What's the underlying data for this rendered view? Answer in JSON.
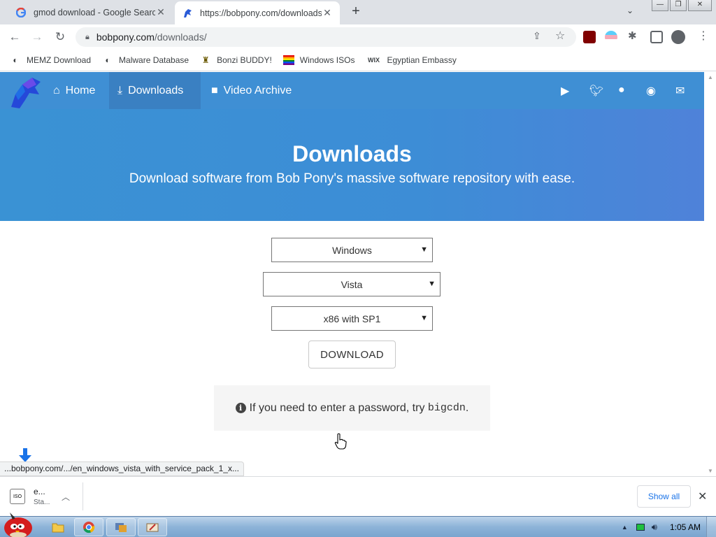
{
  "browser": {
    "tabs": [
      {
        "title": "gmod download - Google Search",
        "active": false
      },
      {
        "title": "https://bobpony.com/downloads",
        "active": true
      }
    ],
    "new_tab": "+",
    "url_domain": "bobpony.com",
    "url_path": "/downloads/",
    "bookmarks": [
      "MEMZ Download",
      "Malware Database",
      "Bonzi BUDDY!",
      "Windows ISOs",
      "Egyptian Embassy"
    ]
  },
  "site": {
    "nav": [
      {
        "label": "Home",
        "icon": "home-icon"
      },
      {
        "label": "Downloads",
        "icon": "download-icon"
      },
      {
        "label": "Video Archive",
        "icon": "video-icon"
      }
    ],
    "social": [
      "youtube-icon",
      "twitter-icon",
      "github-icon",
      "discord-icon",
      "mail-icon"
    ],
    "hero_title": "Downloads",
    "hero_subtitle": "Download software from Bob Pony's massive software repository with ease.",
    "selects": {
      "os": "Windows",
      "version": "Vista",
      "edition": "x86 with SP1"
    },
    "download_button": "DOWNLOAD",
    "notice_text": "If you need to enter a password, try ",
    "notice_code": "bigcdn",
    "notice_end": "."
  },
  "status_url": "...bobpony.com/.../en_windows_vista_with_service_pack_1_x...",
  "download_shelf": {
    "item_name": "e...",
    "item_status": "Sta...",
    "show_all": "Show all"
  },
  "taskbar": {
    "time": "1:05 AM"
  },
  "colors": {
    "nav_bg": "#3f8fd4",
    "hero_bg": "#3d8dd6",
    "link_blue": "#1a73e8"
  }
}
